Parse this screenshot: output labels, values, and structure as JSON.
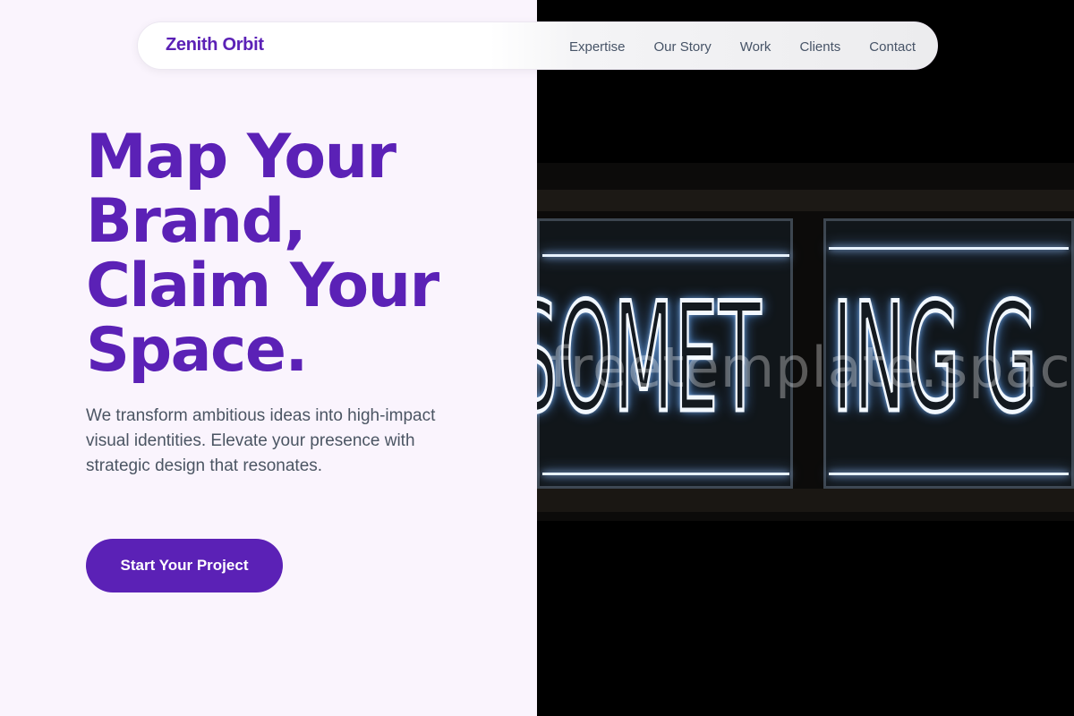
{
  "nav": {
    "brand": "Zenith Orbit",
    "links": [
      "Expertise",
      "Our Story",
      "Work",
      "Clients",
      "Contact"
    ]
  },
  "hero": {
    "headline_lines": [
      "Map Your",
      "Brand,",
      "Claim Your",
      "Space."
    ],
    "subtext": "We transform ambitious ideas into high-impact visual identities. Elevate your presence with strategic design that resonates.",
    "cta_label": "Start Your Project"
  },
  "image": {
    "sign_text_left": "SOMET",
    "sign_text_right": "ING G",
    "watermark": "freetemplate.space"
  },
  "colors": {
    "brand_purple": "#5b21b6",
    "page_background": "#faf4fd",
    "body_text": "#4b5563",
    "nav_link": "#475467"
  }
}
